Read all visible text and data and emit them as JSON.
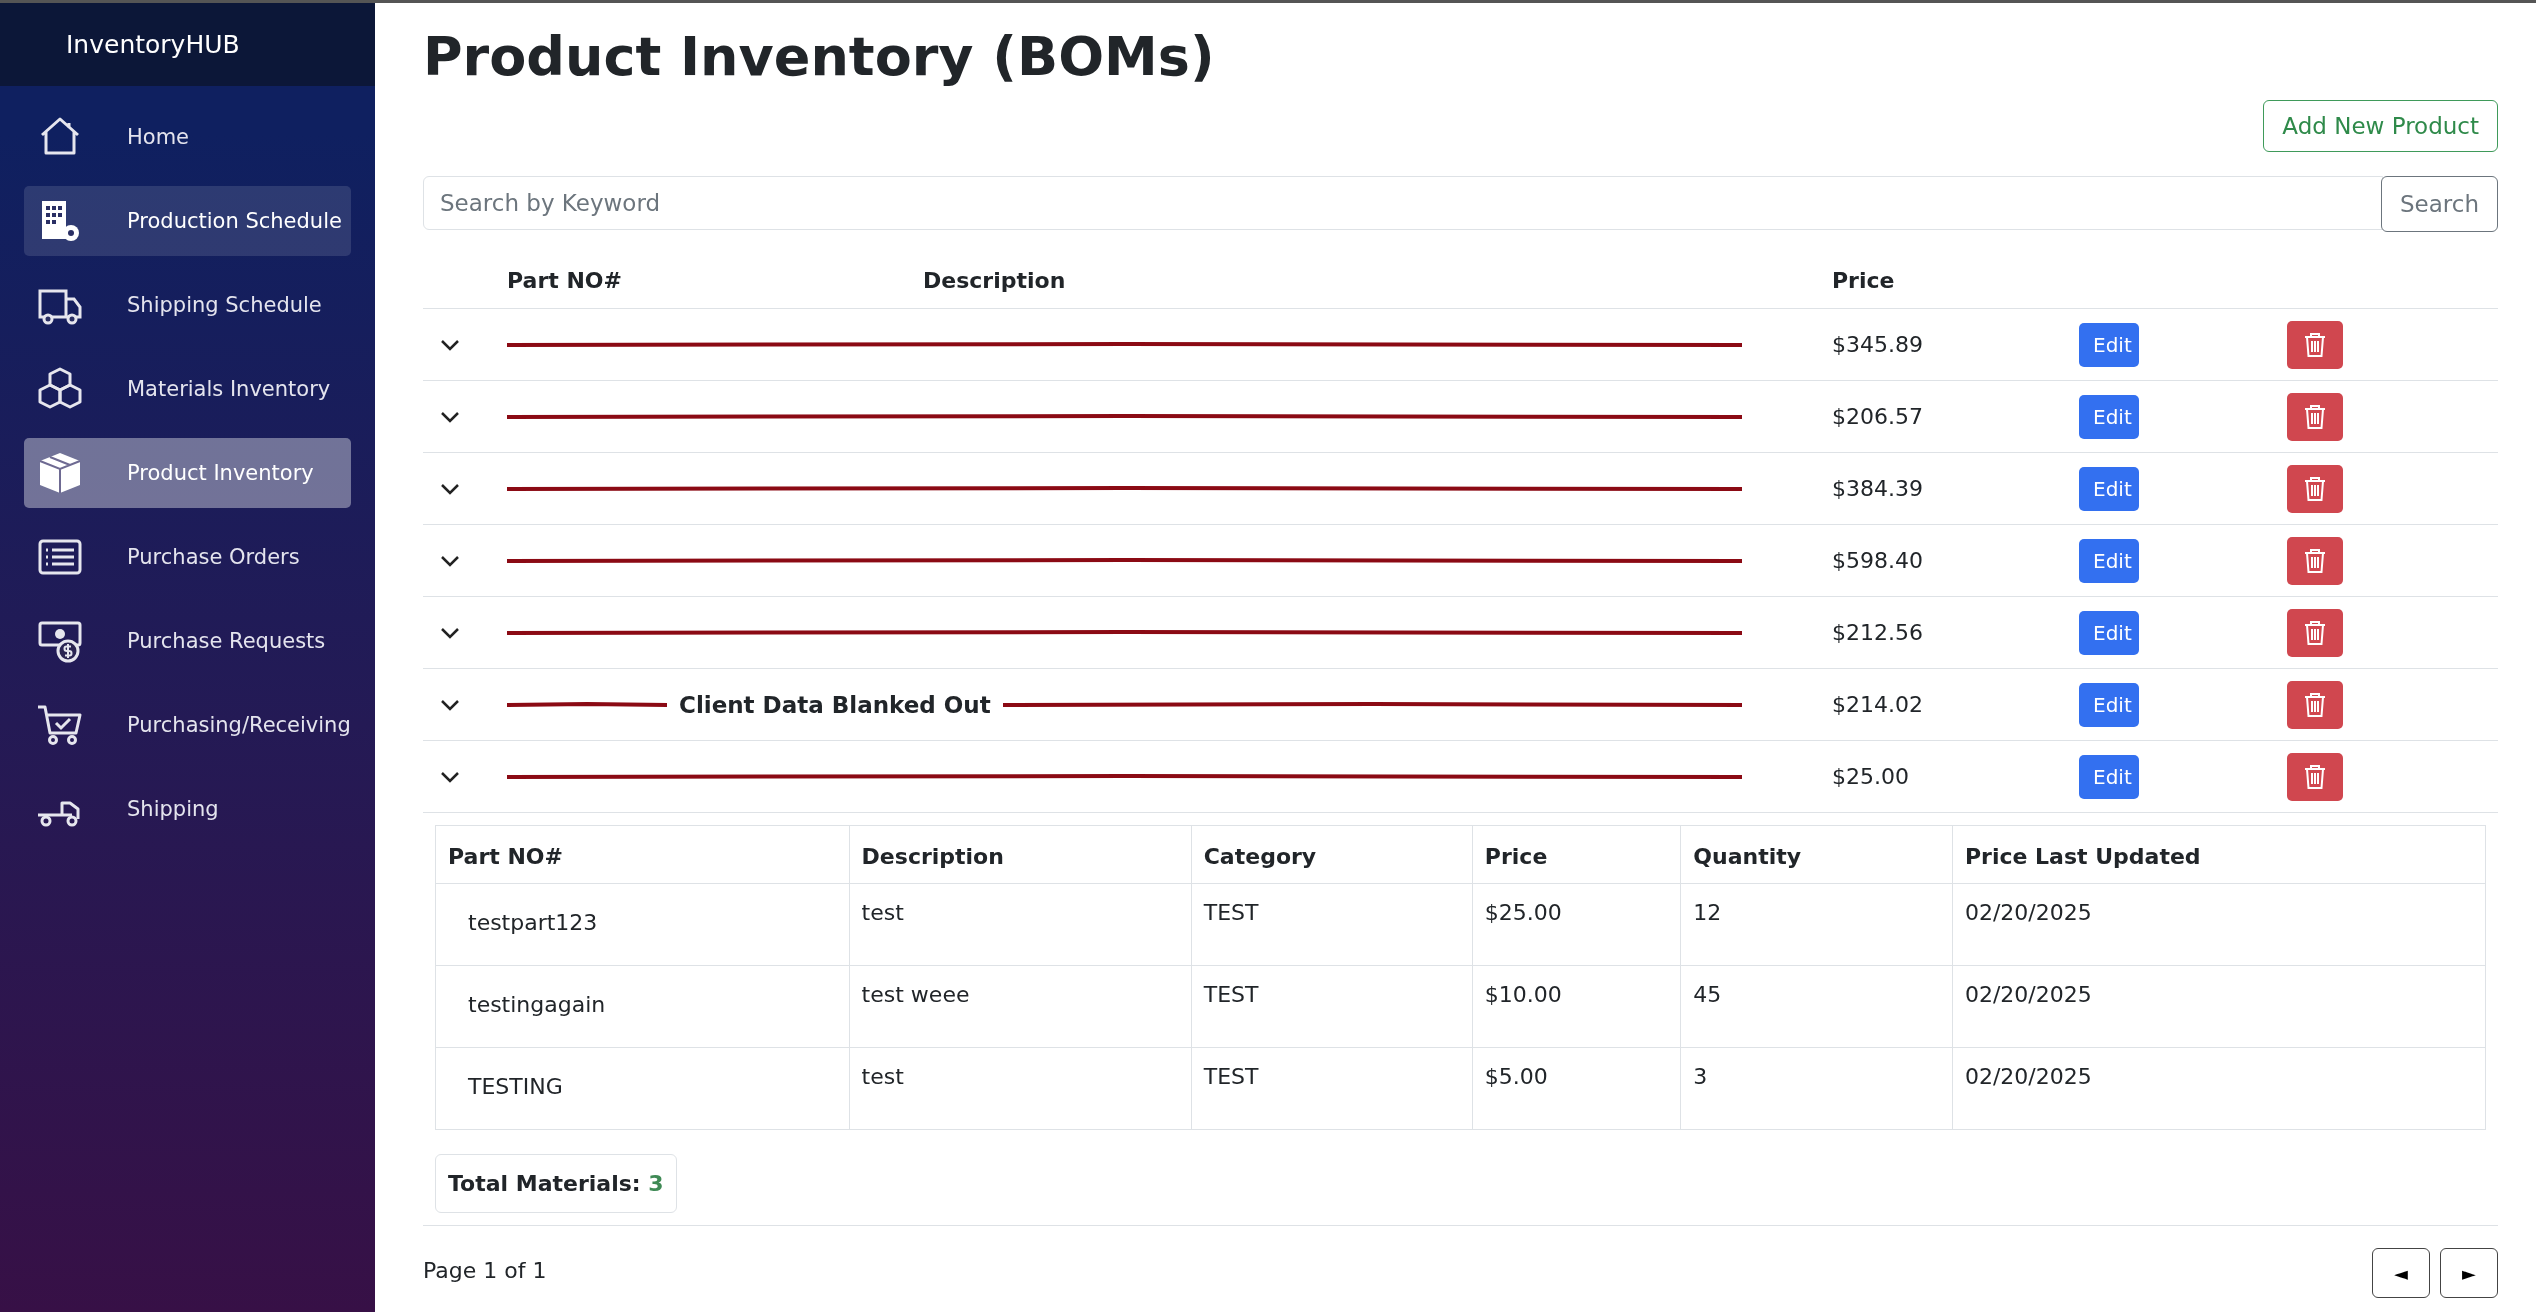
{
  "sidebar": {
    "brand": "InventoryHUB",
    "items": [
      {
        "label": "Home",
        "selected": false,
        "hovered": false
      },
      {
        "label": "Production Schedule",
        "selected": false,
        "hovered": true
      },
      {
        "label": "Shipping Schedule",
        "selected": false,
        "hovered": false
      },
      {
        "label": "Materials Inventory",
        "selected": false,
        "hovered": false
      },
      {
        "label": "Product Inventory",
        "selected": true,
        "hovered": false
      },
      {
        "label": "Purchase Orders",
        "selected": false,
        "hovered": false
      },
      {
        "label": "Purchase Requests",
        "selected": false,
        "hovered": false
      },
      {
        "label": "Purchasing/Receiving",
        "selected": false,
        "hovered": false
      },
      {
        "label": "Shipping",
        "selected": false,
        "hovered": false
      }
    ]
  },
  "page": {
    "title": "Product Inventory (BOMs)",
    "add_button": "Add New Product"
  },
  "search": {
    "placeholder": "Search by Keyword",
    "button": "Search"
  },
  "table": {
    "columns": [
      "Part NO#",
      "Description",
      "Price"
    ],
    "rows": [
      {
        "price": "$345.89",
        "edit": "Edit"
      },
      {
        "price": "$206.57",
        "edit": "Edit"
      },
      {
        "price": "$384.39",
        "edit": "Edit"
      },
      {
        "price": "$598.40",
        "edit": "Edit"
      },
      {
        "price": "$212.56",
        "edit": "Edit"
      },
      {
        "price": "$214.02",
        "edit": "Edit",
        "annotation": "Client Data Blanked Out"
      },
      {
        "price": "$25.00",
        "edit": "Edit"
      }
    ]
  },
  "bom_details": {
    "columns": [
      "Part NO#",
      "Description",
      "Category",
      "Price",
      "Quantity",
      "Price Last Updated"
    ],
    "rows": [
      [
        "testpart123",
        "test",
        "TEST",
        "$25.00",
        "12",
        "02/20/2025"
      ],
      [
        "testingagain",
        "test weee",
        "TEST",
        "$10.00",
        "45",
        "02/20/2025"
      ],
      [
        "TESTING",
        "test",
        "TEST",
        "$5.00",
        "3",
        "02/20/2025"
      ]
    ],
    "total_label": "Total Materials:",
    "total_value": "3"
  },
  "pagination": {
    "info": "Page 1 of 1",
    "prev": "◄",
    "next": "►"
  }
}
